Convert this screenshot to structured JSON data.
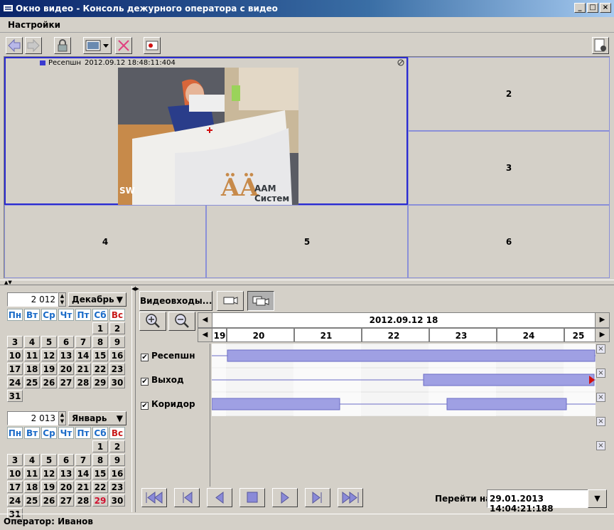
{
  "window": {
    "title": "Окно видео - Консоль дежурного оператора с видео"
  },
  "menu": {
    "settings": "Настройки"
  },
  "video": {
    "cam_name": "Ресепшн",
    "timestamp": "2012.09.12 18:48:11:404",
    "overlay_text": "SW",
    "logo_text": "ААМ Систем",
    "cells": [
      "2",
      "3",
      "4",
      "5",
      "6"
    ]
  },
  "calendar1": {
    "year": "2 012",
    "month": "Декабрь",
    "headers": [
      "Пн",
      "Вт",
      "Ср",
      "Чт",
      "Пт",
      "Сб",
      "Вс"
    ],
    "weeks": [
      [
        "",
        "",
        "",
        "",
        "",
        "1",
        "2"
      ],
      [
        "3",
        "4",
        "5",
        "6",
        "7",
        "8",
        "9"
      ],
      [
        "10",
        "11",
        "12",
        "13",
        "14",
        "15",
        "16"
      ],
      [
        "17",
        "18",
        "19",
        "20",
        "21",
        "22",
        "23"
      ],
      [
        "24",
        "25",
        "26",
        "27",
        "28",
        "29",
        "30"
      ],
      [
        "31",
        "",
        "",
        "",
        "",
        "",
        ""
      ]
    ]
  },
  "calendar2": {
    "year": "2 013",
    "month": "Январь",
    "headers": [
      "Пн",
      "Вт",
      "Ср",
      "Чт",
      "Пт",
      "Сб",
      "Вс"
    ],
    "weeks": [
      [
        "",
        "",
        "",
        "",
        "",
        "1",
        "2"
      ],
      [
        "3",
        "4",
        "5",
        "6",
        "7",
        "8",
        "9"
      ],
      [
        "10",
        "11",
        "12",
        "13",
        "14",
        "15",
        "16"
      ],
      [
        "17",
        "18",
        "19",
        "20",
        "21",
        "22",
        "23"
      ],
      [
        "24",
        "25",
        "26",
        "27",
        "28",
        "29",
        "30"
      ],
      [
        "31",
        "",
        "",
        "",
        "",
        "",
        ""
      ]
    ],
    "today": "29"
  },
  "timeline": {
    "inputs_button": "Видеовходы...",
    "date_header": "2012.09.12 18",
    "hours": [
      "19",
      "20",
      "21",
      "22",
      "23",
      "24",
      "25"
    ],
    "rows": [
      {
        "label": "Ресепшн",
        "checked": true
      },
      {
        "label": "Выход",
        "checked": true
      },
      {
        "label": "Коридор",
        "checked": true
      }
    ]
  },
  "navigation": {
    "goto_label": "Перейти на:",
    "goto_value": "29.01.2013 14:04:21:188"
  },
  "status": {
    "operator": "Оператор: Иванов"
  },
  "colors": {
    "title_start": "#0a246a",
    "selection": "#2b2bd0",
    "bar": "#9fa0e3",
    "weekend": "#c81a1a",
    "weekday_header": "#1a6bc8"
  }
}
